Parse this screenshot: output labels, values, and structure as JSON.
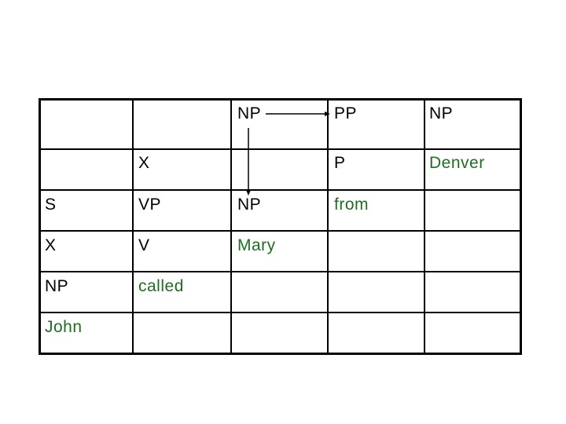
{
  "table": {
    "colors": {
      "category": "#000000",
      "word": "#1f6e1f",
      "line": "#000000"
    },
    "rows": [
      [
        {
          "text": "",
          "type": "empty"
        },
        {
          "text": "",
          "type": "empty"
        },
        {
          "text": "NP",
          "type": "category"
        },
        {
          "text": "PP",
          "type": "category"
        },
        {
          "text": "NP",
          "type": "category"
        }
      ],
      [
        {
          "text": "",
          "type": "empty"
        },
        {
          "text": "X",
          "type": "category"
        },
        {
          "text": "",
          "type": "empty"
        },
        {
          "text": "P",
          "type": "category"
        },
        {
          "text": "Denver",
          "type": "word"
        }
      ],
      [
        {
          "text": "S",
          "type": "category"
        },
        {
          "text": "VP",
          "type": "category"
        },
        {
          "text": "NP",
          "type": "category"
        },
        {
          "text": "from",
          "type": "word"
        },
        {
          "text": "",
          "type": "empty"
        }
      ],
      [
        {
          "text": "X",
          "type": "category"
        },
        {
          "text": "V",
          "type": "category"
        },
        {
          "text": "Mary",
          "type": "word"
        },
        {
          "text": "",
          "type": "empty"
        },
        {
          "text": "",
          "type": "empty"
        }
      ],
      [
        {
          "text": "NP",
          "type": "category"
        },
        {
          "text": "called",
          "type": "word"
        },
        {
          "text": "",
          "type": "empty"
        },
        {
          "text": "",
          "type": "empty"
        },
        {
          "text": "",
          "type": "empty"
        }
      ],
      [
        {
          "text": "John",
          "type": "word"
        },
        {
          "text": "",
          "type": "empty"
        },
        {
          "text": "",
          "type": "empty"
        },
        {
          "text": "",
          "type": "empty"
        },
        {
          "text": "",
          "type": "empty"
        }
      ]
    ],
    "arrows": [
      {
        "from": "row1-col3 NP",
        "to": "row1-col4 PP",
        "direction": "right"
      },
      {
        "from": "row1-col3 NP",
        "to": "row3-col3 NP",
        "direction": "down"
      }
    ]
  }
}
